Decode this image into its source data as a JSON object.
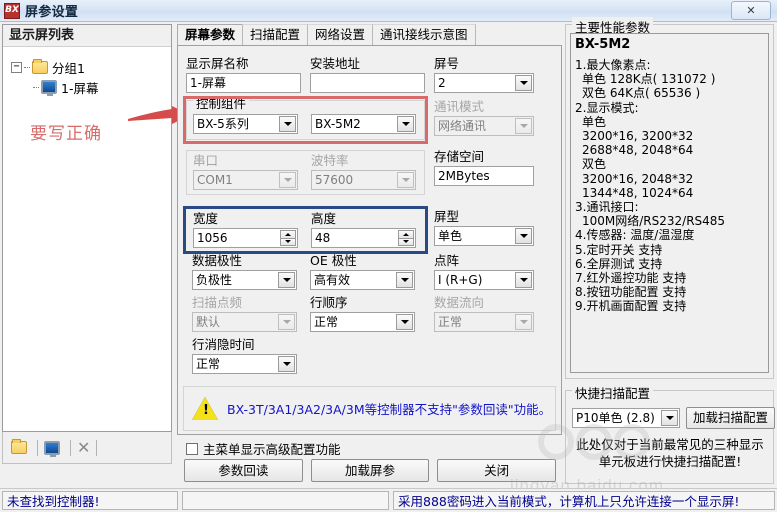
{
  "window": {
    "title": "屏参设置",
    "app_badge": "BX",
    "close_label": "✕"
  },
  "left_panel": {
    "header": "显示屏列表",
    "tree": [
      {
        "expander": "−",
        "icon": "folder-icon",
        "label": "分组1"
      },
      {
        "expander": "",
        "icon": "monitor-icon",
        "label": "1-屏幕"
      }
    ],
    "toolbar": {
      "open_icon": "folder-icon",
      "screen_icon": "monitor-icon",
      "delete_icon": "close-x-icon"
    }
  },
  "annotation": {
    "text": "要写正确",
    "color": "#d86b6b"
  },
  "tabs": [
    {
      "label": "屏幕参数",
      "active": true
    },
    {
      "label": "扫描配置",
      "active": false
    },
    {
      "label": "网络设置",
      "active": false
    },
    {
      "label": "通讯接线示意图",
      "active": false
    }
  ],
  "form": {
    "screen_name": {
      "label": "显示屏名称",
      "value": "1-屏幕"
    },
    "install_addr": {
      "label": "安装地址",
      "value": ""
    },
    "screen_no": {
      "label": "屏号",
      "value": "2"
    },
    "control_group": {
      "legend": "控制组件",
      "series": "BX-5系列",
      "model": "BX-5M2"
    },
    "comm_mode": {
      "label": "通讯模式",
      "value": "网络通讯",
      "disabled": true
    },
    "serial_group": {
      "port": {
        "label": "串口",
        "value": "COM1",
        "disabled": true
      },
      "baud": {
        "label": "波特率",
        "value": "57600",
        "disabled": true
      }
    },
    "storage": {
      "label": "存储空间",
      "value": "2MBytes"
    },
    "width": {
      "label": "宽度",
      "value": "1056"
    },
    "height": {
      "label": "高度",
      "value": "48"
    },
    "screen_type": {
      "label": "屏型",
      "value": "单色"
    },
    "data_polarity": {
      "label": "数据极性",
      "value": "负极性"
    },
    "oe_polarity": {
      "label": "OE 极性",
      "value": "高有效"
    },
    "dot_matrix": {
      "label": "点阵",
      "value": "I (R+G)"
    },
    "scan_freq": {
      "label": "扫描点频",
      "value": "默认",
      "disabled": true
    },
    "row_order": {
      "label": "行顺序",
      "value": "正常"
    },
    "data_flow": {
      "label": "数据流向",
      "value": "正常",
      "disabled": true
    },
    "blank_time": {
      "label": "行消隐时间",
      "value": "正常"
    },
    "warning": "BX-3T/3A1/3A2/3A/3M等控制器不支持\"参数回读\"功能。",
    "advanced_checkbox": {
      "label": "主菜单显示高级配置功能",
      "checked": false
    },
    "buttons": [
      {
        "label": "参数回读"
      },
      {
        "label": "加载屏参"
      },
      {
        "label": "关闭"
      }
    ]
  },
  "right_panel": {
    "legend": "主要性能参数",
    "model": "BX-5M2",
    "lines": [
      {
        "text": "1.最大像素点:",
        "indent": 0
      },
      {
        "text": "单色 128K点( 131072 )",
        "indent": 1
      },
      {
        "text": "双色 64K点( 65536 )",
        "indent": 1
      },
      {
        "text": "2.显示模式:",
        "indent": 0
      },
      {
        "text": "单色",
        "indent": 1
      },
      {
        "text": "3200*16, 3200*32",
        "indent": 1
      },
      {
        "text": "2688*48, 2048*64",
        "indent": 1
      },
      {
        "text": "双色",
        "indent": 1
      },
      {
        "text": "3200*16, 2048*32",
        "indent": 1
      },
      {
        "text": "1344*48, 1024*64",
        "indent": 1
      },
      {
        "text": "3.通讯接口:",
        "indent": 0
      },
      {
        "text": "100M网络/RS232/RS485",
        "indent": 1
      },
      {
        "text": "4.传感器: 温度/温湿度",
        "indent": 0
      },
      {
        "text": "5.定时开关 支持",
        "indent": 0
      },
      {
        "text": "6.全屏测试 支持",
        "indent": 0
      },
      {
        "text": "7.红外遥控功能 支持",
        "indent": 0
      },
      {
        "text": "8.按钮功能配置 支持",
        "indent": 0
      },
      {
        "text": "9.开机画面配置 支持",
        "indent": 0
      }
    ],
    "scan_config": {
      "legend": "快捷扫描配置",
      "selected": "P10单色 (2.8)",
      "button": "加载扫描配置",
      "note": "此处仅对于当前最常见的三种显示单元板进行快捷扫描配置!"
    }
  },
  "status_bar": {
    "left": "未查找到控制器!",
    "middle": "",
    "right": "采用888密码进入当前模式，计算机上只允许连接一个显示屏!"
  },
  "watermark": {
    "text": "jingyan.baidu.com"
  }
}
